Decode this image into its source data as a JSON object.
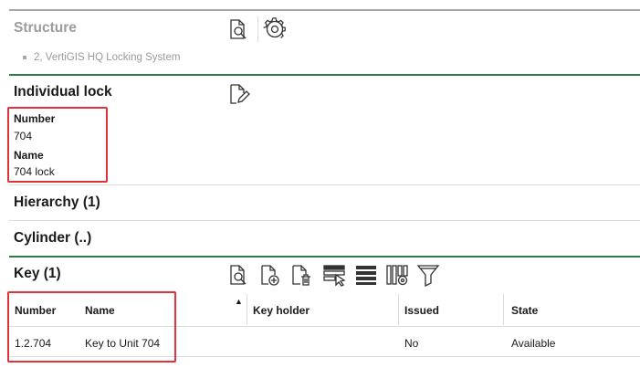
{
  "structure": {
    "title": "Structure",
    "item": "2, VertiGIS HQ Locking System"
  },
  "lock": {
    "title": "Individual lock",
    "number_label": "Number",
    "number_value": "704",
    "name_label": "Name",
    "name_value": "704 lock"
  },
  "hierarchy": {
    "title": "Hierarchy (1)"
  },
  "cylinder": {
    "title": "Cylinder (..)"
  },
  "key": {
    "title": "Key (1)",
    "sort_indicator": "▲",
    "columns": [
      "Number",
      "Name",
      "Key holder",
      "Issued",
      "State"
    ],
    "rows": [
      [
        "1.2.704",
        "Key to Unit 704",
        "",
        "No",
        "Available"
      ]
    ]
  },
  "colors": {
    "accent_green": "#2d7a45",
    "highlight_red": "#e0333b",
    "muted_text": "#9c9c9c"
  },
  "icons": {
    "structure_toolbar": [
      "document-search-icon",
      "gear-icon"
    ],
    "lock_toolbar": [
      "document-edit-icon"
    ],
    "key_toolbar": [
      "document-search-icon",
      "document-add-icon",
      "document-delete-icon",
      "select-rows-icon",
      "rows-icon",
      "column-settings-icon",
      "filter-icon"
    ]
  }
}
